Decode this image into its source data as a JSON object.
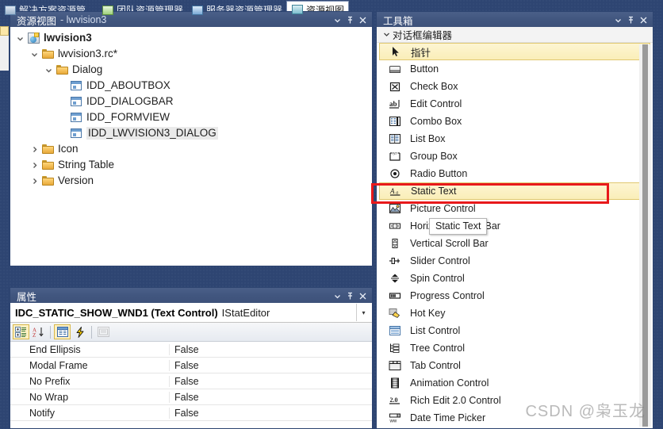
{
  "resource_view": {
    "title_main": "资源视图",
    "title_sub": "- lwvision3",
    "buttons": {
      "dropdown": "▾",
      "pin": "⚲",
      "close": "✕"
    },
    "tree": [
      {
        "label": "lwvision3",
        "indent": 0,
        "chevron": "down",
        "icon": "project-icon",
        "bold": true,
        "selected": false
      },
      {
        "label": "lwvision3.rc*",
        "indent": 1,
        "chevron": "down",
        "icon": "folder-icon",
        "bold": false,
        "selected": false
      },
      {
        "label": "Dialog",
        "indent": 2,
        "chevron": "down",
        "icon": "folder-icon",
        "bold": false,
        "selected": false
      },
      {
        "label": "IDD_ABOUTBOX",
        "indent": 3,
        "chevron": "none",
        "icon": "dialog-icon",
        "bold": false,
        "selected": false
      },
      {
        "label": "IDD_DIALOGBAR",
        "indent": 3,
        "chevron": "none",
        "icon": "dialog-icon",
        "bold": false,
        "selected": false
      },
      {
        "label": "IDD_FORMVIEW",
        "indent": 3,
        "chevron": "none",
        "icon": "dialog-icon",
        "bold": false,
        "selected": false
      },
      {
        "label": "IDD_LWVISION3_DIALOG",
        "indent": 3,
        "chevron": "none",
        "icon": "dialog-icon",
        "bold": false,
        "selected": true
      },
      {
        "label": "Icon",
        "indent": 1,
        "chevron": "right",
        "icon": "folder-icon",
        "bold": false,
        "selected": false
      },
      {
        "label": "String Table",
        "indent": 1,
        "chevron": "right",
        "icon": "folder-icon",
        "bold": false,
        "selected": false
      },
      {
        "label": "Version",
        "indent": 1,
        "chevron": "right",
        "icon": "folder-icon",
        "bold": false,
        "selected": false
      }
    ]
  },
  "doc_tabs": [
    {
      "label": "解决方案资源管...",
      "icon": "solution-explorer-icon",
      "active": false
    },
    {
      "label": "团队资源管理器",
      "icon": "team-explorer-icon",
      "active": false
    },
    {
      "label": "服务器资源管理器",
      "icon": "server-explorer-icon",
      "active": false
    },
    {
      "label": "资源视图",
      "icon": "resource-view-icon",
      "active": true
    }
  ],
  "properties": {
    "title": "属性",
    "buttons": {
      "dropdown": "▾",
      "pin": "⚲",
      "close": "✕"
    },
    "object_name": "IDC_STATIC_SHOW_WND1 (Text Control)",
    "object_type": "IStatEditor",
    "dropdown_glyph": "▾",
    "toolbar": [
      {
        "name": "categorized-button",
        "state": "on"
      },
      {
        "name": "alphabetical-button",
        "state": "off"
      },
      {
        "name": "properties-button",
        "state": "on"
      },
      {
        "name": "events-button",
        "state": "off"
      },
      {
        "name": "property-pages-button",
        "state": "disabled"
      }
    ],
    "rows": [
      {
        "name": "End Ellipsis",
        "value": "False"
      },
      {
        "name": "Modal Frame",
        "value": "False"
      },
      {
        "name": "No Prefix",
        "value": "False"
      },
      {
        "name": "No Wrap",
        "value": "False"
      },
      {
        "name": "Notify",
        "value": "False"
      }
    ]
  },
  "toolbox": {
    "title": "工具箱",
    "buttons": {
      "dropdown": "▾",
      "pin": "⚲",
      "close": "✕"
    },
    "group_label": "对话框编辑器",
    "items": [
      {
        "label": "指针",
        "icon": "pointer-icon",
        "selected": true,
        "highlighted": false
      },
      {
        "label": "Button",
        "icon": "button-icon",
        "selected": false,
        "highlighted": false
      },
      {
        "label": "Check Box",
        "icon": "checkbox-icon",
        "selected": false,
        "highlighted": false
      },
      {
        "label": "Edit Control",
        "icon": "edit-control-icon",
        "selected": false,
        "highlighted": false
      },
      {
        "label": "Combo Box",
        "icon": "combo-box-icon",
        "selected": false,
        "highlighted": false
      },
      {
        "label": "List Box",
        "icon": "list-box-icon",
        "selected": false,
        "highlighted": false
      },
      {
        "label": "Group Box",
        "icon": "group-box-icon",
        "selected": false,
        "highlighted": false
      },
      {
        "label": "Radio Button",
        "icon": "radio-button-icon",
        "selected": false,
        "highlighted": false
      },
      {
        "label": "Static Text",
        "icon": "static-text-icon",
        "selected": true,
        "highlighted": true
      },
      {
        "label": "Picture Control",
        "icon": "picture-control-icon",
        "selected": false,
        "highlighted": false
      },
      {
        "label": "Horizontal Scroll Bar",
        "icon": "hscrollbar-icon",
        "selected": false,
        "highlighted": false
      },
      {
        "label": "Vertical Scroll Bar",
        "icon": "vscrollbar-icon",
        "selected": false,
        "highlighted": false
      },
      {
        "label": "Slider Control",
        "icon": "slider-control-icon",
        "selected": false,
        "highlighted": false
      },
      {
        "label": "Spin Control",
        "icon": "spin-control-icon",
        "selected": false,
        "highlighted": false
      },
      {
        "label": "Progress Control",
        "icon": "progress-control-icon",
        "selected": false,
        "highlighted": false
      },
      {
        "label": "Hot Key",
        "icon": "hot-key-icon",
        "selected": false,
        "highlighted": false
      },
      {
        "label": "List Control",
        "icon": "list-control-icon",
        "selected": false,
        "highlighted": false
      },
      {
        "label": "Tree Control",
        "icon": "tree-control-icon",
        "selected": false,
        "highlighted": false
      },
      {
        "label": "Tab Control",
        "icon": "tab-control-icon",
        "selected": false,
        "highlighted": false
      },
      {
        "label": "Animation Control",
        "icon": "animation-control-icon",
        "selected": false,
        "highlighted": false
      },
      {
        "label": "Rich Edit 2.0 Control",
        "icon": "rich-edit-icon",
        "selected": false,
        "highlighted": false
      },
      {
        "label": "Date Time Picker",
        "icon": "date-time-picker-icon",
        "selected": false,
        "highlighted": false
      }
    ]
  },
  "tooltip": {
    "text": "Static Text"
  },
  "watermark": {
    "text": "CSDN @枭玉龙"
  },
  "colors": {
    "chrome": "#2e4572",
    "title_bar": "#41567f",
    "highlight_yellow": "#faeeb8",
    "annotation_red": "#e8191b"
  }
}
